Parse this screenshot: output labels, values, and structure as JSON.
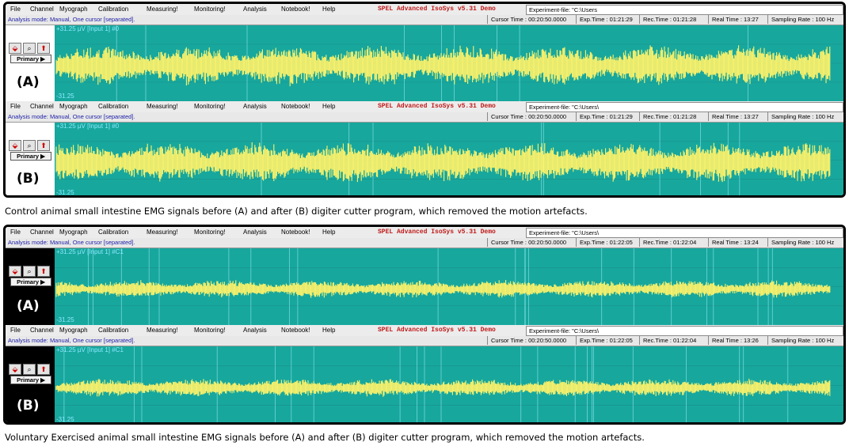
{
  "figure1": {
    "caption": "Control animal small intestine EMG signals before (A) and after (B) digiter cutter program, which removed the motion artefacts.",
    "panels": [
      {
        "letter": "(A)",
        "menu": [
          "File",
          "Channel",
          "Myograph",
          "Calibration",
          "Measuring!",
          "Monitoring!",
          "Analysis",
          "Notebook!",
          "Help"
        ],
        "app_title": "SPEL Advanced IsoSys v5.31 Demo",
        "experiment_file": "Experiment-file: \"C:\\Users",
        "analysis_mode": "Analysis mode: Manual, One cursor [separated].",
        "cursor_time": "Cursor Time : 00:20:50.0000",
        "exp_time": "Exp.Time : 01:21:29",
        "rec_time": "Rec.Time : 01:21:28",
        "real_time": "Real Time : 13:27",
        "sampling_rate": "Sampling Rate : 100 Hz",
        "scale_top": "+31.25 µV [Input 1] #0",
        "scale_bottom": "-31.25",
        "primary_label": "Primary ▶"
      },
      {
        "letter": "(B)",
        "menu": [
          "File",
          "Channel",
          "Myograph",
          "Calibration",
          "Measuring!",
          "Monitoring!",
          "Analysis",
          "Notebook!",
          "Help"
        ],
        "app_title": "SPEL Advanced IsoSys v5.31 Demo",
        "experiment_file": "Experiment-file: \"C:\\Users\\",
        "analysis_mode": "Analysis mode: Manual, One cursor [separated].",
        "cursor_time": "Cursor Time : 00:20:50.0000",
        "exp_time": "Exp.Time : 01:21:29",
        "rec_time": "Rec.Time : 01:21:28",
        "real_time": "Real Time : 13:27",
        "sampling_rate": "Sampling Rate : 100 Hz",
        "scale_top": "+31.25 µV [Input 1] #0",
        "scale_bottom": "-31.25",
        "primary_label": "Primary ▶"
      }
    ]
  },
  "figure2": {
    "caption": "Voluntary Exercised animal small intestine EMG signals before (A) and after (B) digiter cutter program, which removed the motion artefacts.",
    "panels": [
      {
        "letter": "(A)",
        "menu": [
          "File",
          "Channel",
          "Myograph",
          "Calibration",
          "Measuring!",
          "Monitoring!",
          "Analysis",
          "Notebook!",
          "Help"
        ],
        "app_title": "SPEL Advanced IsoSys v5.31 Demo",
        "experiment_file": "Experiment-file: \"C:\\Users\\",
        "analysis_mode": "Analysis mode: Manual, One cursor [separated].",
        "cursor_time": "Cursor Time : 00:20:50.0000",
        "exp_time": "Exp.Time : 01:22:05",
        "rec_time": "Rec.Time : 01:22:04",
        "real_time": "Real Time : 13:24",
        "sampling_rate": "Sampling Rate : 100 Hz",
        "scale_top": "+31.25 µV [Input 1] #C1",
        "scale_bottom": "-31.25",
        "primary_label": "Primary ▶"
      },
      {
        "letter": "(B)",
        "menu": [
          "File",
          "Channel",
          "Myograph",
          "Calibration",
          "Measuring!",
          "Monitoring!",
          "Analysis",
          "Notebook!",
          "Help"
        ],
        "app_title": "SPEL Advanced IsoSys v5.31 Demo",
        "experiment_file": "Experiment-file: \"C:\\Users\\",
        "analysis_mode": "Analysis mode: Manual, One cursor [separated].",
        "cursor_time": "Cursor Time : 00:20:50.0000",
        "exp_time": "Exp.Time : 01:22:05",
        "rec_time": "Rec.Time : 01:22:04",
        "real_time": "Real Time : 13:26",
        "sampling_rate": "Sampling Rate : 100 Hz",
        "scale_top": "+31.25 µV [Input 1] #C1",
        "scale_bottom": "-31.25",
        "primary_label": "Primary ▶"
      }
    ]
  },
  "colors": {
    "plot_background": "#17a79d",
    "signal": "#fff36a",
    "gridline": "#8fe6f0",
    "app_title": "#c01818"
  },
  "icons": [
    "record-icon",
    "zoom-icon",
    "arrow-up-icon",
    "play-triangle-icon"
  ]
}
